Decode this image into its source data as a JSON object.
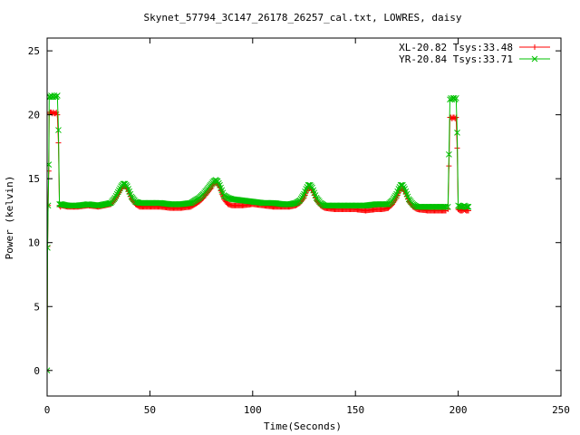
{
  "chart_data": {
    "type": "scatter",
    "title": "Skynet_57794_3C147_26178_26257_cal.txt, LOWRES, daisy",
    "xlabel": "Time(Seconds)",
    "ylabel": "Power (kelvin)",
    "xlim": [
      0,
      250
    ],
    "ylim": [
      -2,
      26
    ],
    "xticks": [
      0,
      50,
      100,
      150,
      200,
      250
    ],
    "yticks": [
      0,
      5,
      10,
      15,
      20,
      25
    ],
    "grid": false,
    "legend_position": "top-right",
    "series": [
      {
        "name": "XL-20.82 Tsys:33.48",
        "color": "#ff0000",
        "marker": "plus",
        "segments": [
          {
            "x": [
              0,
              0.2,
              0.5,
              0.8,
              1.0,
              1.5,
              2.0,
              2.5,
              3.0,
              3.5,
              4.0,
              4.5,
              5.0,
              5.5,
              6.0,
              6.5
            ],
            "y": [
              0,
              9.7,
              12.9,
              15.6,
              20.1,
              20.2,
              20.2,
              20.1,
              20.2,
              20.1,
              20.1,
              20.2,
              20.0,
              17.8,
              12.9,
              12.8
            ]
          },
          {
            "x": [
              7,
              10,
              15,
              20,
              25,
              28,
              31,
              33,
              35,
              36,
              37,
              38,
              39,
              40,
              41,
              43,
              45,
              50,
              55,
              60,
              65,
              70,
              72,
              74,
              76,
              78,
              80,
              81,
              82,
              83,
              84,
              85,
              86,
              88,
              90,
              95,
              100,
              105,
              110,
              115,
              118,
              121,
              123,
              125,
              126,
              127,
              128,
              129,
              130,
              131,
              133,
              135,
              140,
              145,
              150,
              155,
              160,
              163,
              166,
              168,
              170,
              171,
              172,
              173,
              174,
              175,
              176,
              178,
              180,
              185,
              190,
              194
            ],
            "y": [
              12.9,
              12.8,
              12.8,
              12.9,
              12.8,
              12.9,
              13.0,
              13.4,
              13.9,
              14.2,
              14.4,
              14.4,
              14.2,
              13.8,
              13.4,
              13.0,
              12.8,
              12.8,
              12.8,
              12.7,
              12.7,
              12.8,
              13.0,
              13.2,
              13.5,
              13.9,
              14.3,
              14.6,
              14.7,
              14.6,
              14.3,
              13.8,
              13.4,
              13.0,
              12.9,
              12.9,
              13.0,
              12.9,
              12.8,
              12.8,
              12.8,
              12.9,
              13.1,
              13.5,
              13.9,
              14.2,
              14.3,
              14.1,
              13.7,
              13.3,
              12.9,
              12.7,
              12.6,
              12.6,
              12.6,
              12.5,
              12.6,
              12.6,
              12.7,
              13.0,
              13.5,
              13.9,
              14.2,
              14.2,
              14.0,
              13.6,
              13.2,
              12.8,
              12.6,
              12.5,
              12.5,
              12.5
            ]
          },
          {
            "x": [
              195.0,
              195.5,
              196.0,
              196.5,
              197.0,
              197.5,
              198.0,
              198.5,
              199.0,
              199.5,
              200.0,
              201.0,
              202.0,
              203.0,
              204.0,
              205.0
            ],
            "y": [
              12.6,
              16.0,
              19.8,
              19.8,
              19.7,
              19.8,
              19.8,
              19.7,
              19.8,
              17.4,
              12.6,
              12.5,
              12.5,
              12.6,
              12.5,
              12.5
            ]
          }
        ]
      },
      {
        "name": "YR-20.84 Tsys:33.71",
        "color": "#00c000",
        "marker": "cross",
        "segments": [
          {
            "x": [
              0,
              0.2,
              0.5,
              0.8,
              1.0,
              1.5,
              2.0,
              2.5,
              3.0,
              3.5,
              4.0,
              4.5,
              5.0,
              5.5,
              6.0,
              6.5
            ],
            "y": [
              0,
              9.6,
              12.9,
              16.1,
              21.4,
              21.4,
              21.5,
              21.4,
              21.4,
              21.5,
              21.4,
              21.4,
              21.5,
              18.8,
              13.0,
              13.0
            ]
          },
          {
            "x": [
              7,
              10,
              15,
              20,
              25,
              28,
              31,
              33,
              35,
              36,
              37,
              38,
              39,
              40,
              41,
              43,
              45,
              50,
              55,
              60,
              65,
              70,
              72,
              74,
              76,
              78,
              80,
              81,
              82,
              83,
              84,
              85,
              86,
              88,
              90,
              95,
              100,
              105,
              110,
              115,
              118,
              121,
              123,
              125,
              126,
              127,
              128,
              129,
              130,
              131,
              133,
              135,
              140,
              145,
              150,
              155,
              160,
              163,
              166,
              168,
              170,
              171,
              172,
              173,
              174,
              175,
              176,
              178,
              180,
              185,
              190,
              194
            ],
            "y": [
              13.0,
              12.9,
              12.9,
              13.0,
              12.9,
              13.0,
              13.1,
              13.5,
              14.1,
              14.4,
              14.6,
              14.6,
              14.4,
              14.0,
              13.6,
              13.2,
              13.1,
              13.1,
              13.1,
              13.0,
              13.0,
              13.1,
              13.3,
              13.5,
              13.8,
              14.2,
              14.6,
              14.8,
              14.9,
              14.8,
              14.5,
              14.1,
              13.7,
              13.5,
              13.4,
              13.3,
              13.2,
              13.1,
              13.1,
              13.0,
              13.0,
              13.1,
              13.3,
              13.8,
              14.2,
              14.5,
              14.5,
              14.3,
              13.9,
              13.5,
              13.1,
              12.9,
              12.9,
              12.9,
              12.9,
              12.9,
              13.0,
              13.0,
              13.0,
              13.3,
              13.8,
              14.2,
              14.5,
              14.5,
              14.2,
              13.8,
              13.4,
              13.0,
              12.8,
              12.8,
              12.8,
              12.8
            ]
          },
          {
            "x": [
              195.0,
              195.5,
              196.0,
              196.5,
              197.0,
              197.5,
              198.0,
              198.5,
              199.0,
              199.5,
              200.0,
              201.0,
              202.0,
              203.0,
              204.0,
              205.0
            ],
            "y": [
              12.8,
              16.9,
              21.2,
              21.3,
              21.2,
              21.3,
              21.3,
              21.2,
              21.3,
              18.6,
              12.9,
              12.8,
              12.8,
              12.9,
              12.8,
              12.8
            ]
          }
        ]
      }
    ]
  }
}
